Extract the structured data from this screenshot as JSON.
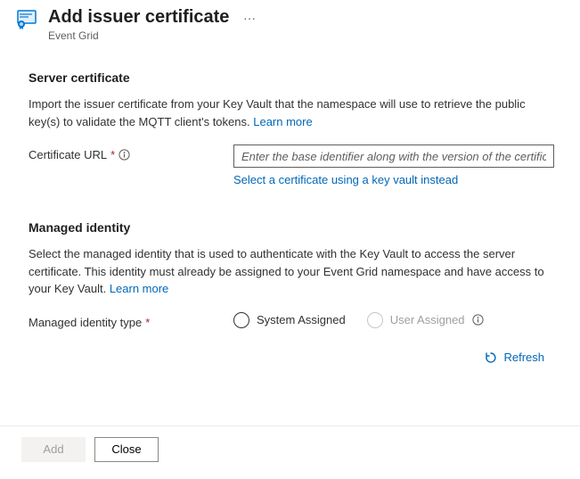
{
  "header": {
    "title": "Add issuer certificate",
    "subtitle": "Event Grid"
  },
  "server_cert": {
    "title": "Server certificate",
    "desc": "Import the issuer certificate from your Key Vault that the namespace will use to retrieve the public key(s) to validate the MQTT client's tokens. ",
    "learn_more": "Learn more",
    "field_label": "Certificate URL",
    "placeholder": "Enter the base identifier along with the version of the certificate",
    "kv_link": "Select a certificate using a key vault instead"
  },
  "managed_identity": {
    "title": "Managed identity",
    "desc": "Select the managed identity that is used to authenticate with the Key Vault to access the server certificate. This identity must already be assigned to your Event Grid namespace and have access to your Key Vault. ",
    "learn_more": "Learn more",
    "type_label": "Managed identity type",
    "options": {
      "system": "System Assigned",
      "user": "User Assigned"
    },
    "refresh": "Refresh"
  },
  "footer": {
    "add": "Add",
    "close": "Close"
  }
}
